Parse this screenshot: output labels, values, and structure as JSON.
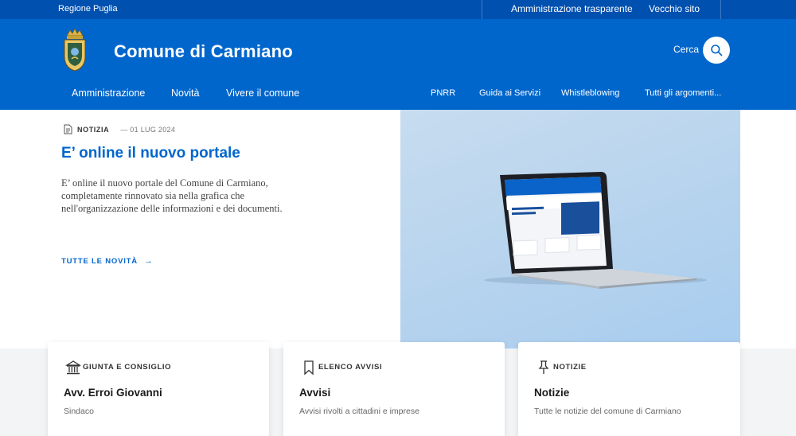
{
  "slim_header": {
    "region": "Regione Puglia",
    "links": [
      "Amministrazione trasparente",
      "Vecchio sito"
    ]
  },
  "header": {
    "title": "Comune di Carmiano",
    "search_label": "Cerca",
    "search_icon": "search-icon"
  },
  "nav": {
    "main": [
      "Amministrazione",
      "Novità",
      "Vivere il comune"
    ],
    "secondary": [
      "PNRR",
      "Guida ai Servizi",
      "Whistleblowing",
      "Tutti gli argomenti..."
    ]
  },
  "hero": {
    "category": "NOTIZIA",
    "date": "— 01 LUG 2024",
    "title": "E’ online il nuovo portale",
    "text": "E’ online il nuovo portale del Comune di Carmiano, completamente rinnovato sia nella grafica che nell'organizzazione delle informazioni e dei documenti.",
    "link": "TUTTE LE NOVITÀ",
    "link_arrow": "→"
  },
  "cards": [
    {
      "icon": "institution-icon",
      "category": "GIUNTA E CONSIGLIO",
      "title": "Avv. Erroi Giovanni",
      "description": "Sindaco"
    },
    {
      "icon": "bookmark-icon",
      "category": "ELENCO AVVISI",
      "title": "Avvisi",
      "description": "Avvisi rivolti a cittadini e imprese"
    },
    {
      "icon": "pin-icon",
      "category": "NOTIZIE",
      "title": "Notizie",
      "description": "Tutte le notizie del comune di Carmiano"
    }
  ],
  "colors": {
    "primary": "#0066cc",
    "slim": "#0050b0"
  }
}
